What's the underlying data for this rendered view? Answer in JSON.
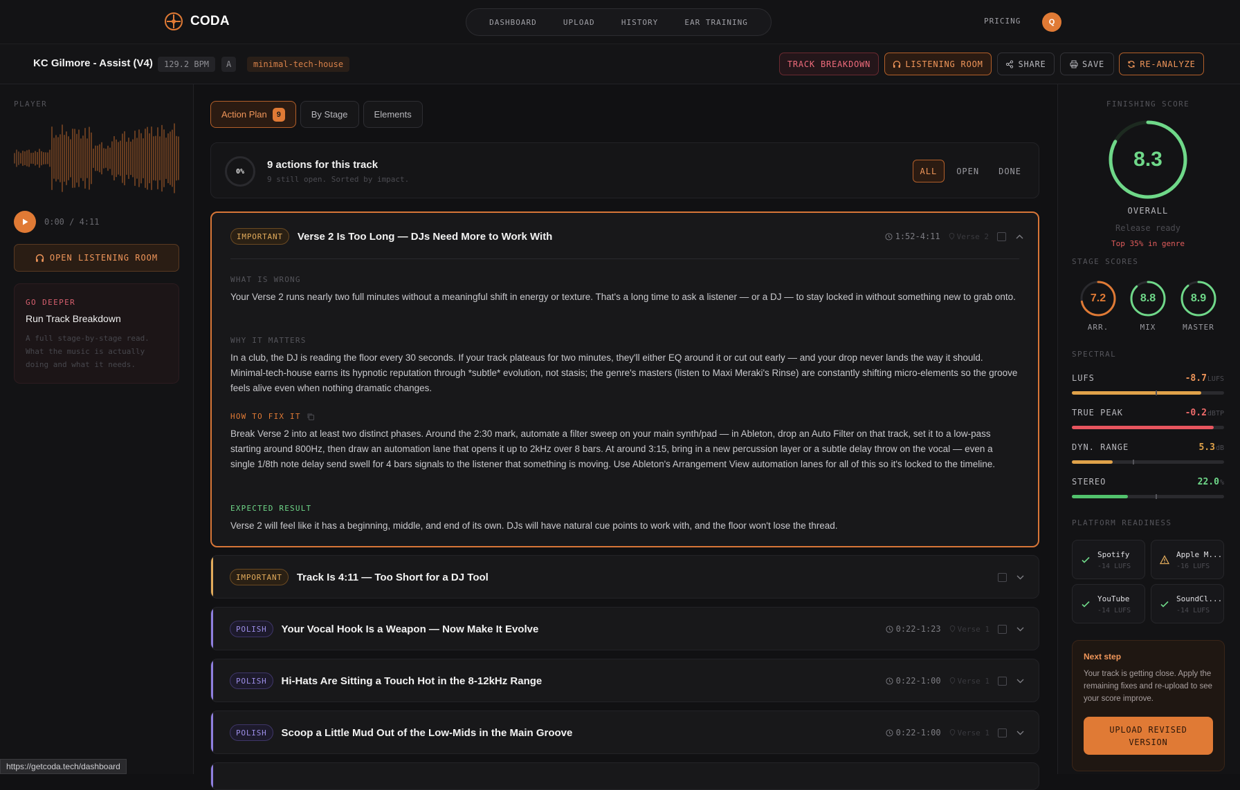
{
  "app": {
    "name": "CODA",
    "avatar_letter": "Q",
    "status_url": "https://getcoda.tech/dashboard"
  },
  "nav": {
    "items": [
      "DASHBOARD",
      "UPLOAD",
      "HISTORY",
      "EAR TRAINING"
    ],
    "pricing": "PRICING"
  },
  "track": {
    "title": "KC Gilmore - Assist (V4)",
    "bpm": "129.2 BPM",
    "key": "A",
    "genre": "minimal-tech-house",
    "buttons": {
      "breakdown": "TRACK BREAKDOWN",
      "listening": "LISTENING ROOM",
      "share": "SHARE",
      "save": "SAVE",
      "reanalyze": "RE-ANALYZE"
    }
  },
  "player": {
    "label": "PLAYER",
    "time": "0:00 / 4:11",
    "open_listening": "OPEN LISTENING ROOM",
    "go_deeper": {
      "eyebrow": "GO DEEPER",
      "title": "Run Track Breakdown",
      "desc": "A full stage-by-stage read. What the music is actually doing and what it needs."
    }
  },
  "tabs": [
    {
      "label": "Action Plan",
      "count": "9"
    },
    {
      "label": "By Stage"
    },
    {
      "label": "Elements"
    }
  ],
  "summary": {
    "pct": "0%",
    "title": "9 actions for this track",
    "sub": "9 still open. Sorted by impact.",
    "filters": [
      "ALL",
      "OPEN",
      "DONE"
    ]
  },
  "actions": [
    {
      "tag": "IMPORTANT",
      "title": "Verse 2 Is Too Long — DJs Need More to Work With",
      "time": "1:52-4:11",
      "section": "Verse 2",
      "wrong_label": "WHAT IS WRONG",
      "wrong": "Your Verse 2 runs nearly two full minutes without a meaningful shift in energy or texture. That's a long time to ask a listener — or a DJ — to stay locked in without something new to grab onto.",
      "why_label": "WHY IT MATTERS",
      "why": "In a club, the DJ is reading the floor every 30 seconds. If your track plateaus for two minutes, they'll either EQ around it or cut out early — and your drop never lands the way it should. Minimal-tech-house earns its hypnotic reputation through *subtle* evolution, not stasis; the genre's masters (listen to Maxi Meraki's Rinse) are constantly shifting micro-elements so the groove feels alive even when nothing dramatic changes.",
      "fix_label": "HOW TO FIX IT",
      "fix": "Break Verse 2 into at least two distinct phases. Around the 2:30 mark, automate a filter sweep on your main synth/pad — in Ableton, drop an Auto Filter on that track, set it to a low-pass starting around 800Hz, then draw an automation lane that opens it up to 2kHz over 8 bars. At around 3:15, bring in a new percussion layer or a subtle delay throw on the vocal — even a single 1/8th note delay send swell for 4 bars signals to the listener that something is moving. Use Ableton's Arrangement View automation lanes for all of this so it's locked to the timeline.",
      "result_label": "EXPECTED RESULT",
      "result": "Verse 2 will feel like it has a beginning, middle, and end of its own. DJs will have natural cue points to work with, and the floor won't lose the thread."
    },
    {
      "tag": "IMPORTANT",
      "title": "Track Is 4:11 — Too Short for a DJ Tool"
    },
    {
      "tag": "POLISH",
      "title": "Your Vocal Hook Is a Weapon — Now Make It Evolve",
      "time": "0:22-1:23",
      "section": "Verse 1"
    },
    {
      "tag": "POLISH",
      "title": "Hi-Hats Are Sitting a Touch Hot in the 8-12kHz Range",
      "time": "0:22-1:00",
      "section": "Verse 1"
    },
    {
      "tag": "POLISH",
      "title": "Scoop a Little Mud Out of the Low-Mids in the Main Groove",
      "time": "0:22-1:00",
      "section": "Verse 1"
    }
  ],
  "score": {
    "label": "FINISHING SCORE",
    "overall": "8.3",
    "overall_value": 8.3,
    "overall_label": "OVERALL",
    "status": "Release ready",
    "rank": "Top 35% in genre",
    "stages_label": "STAGE SCORES",
    "stages": [
      {
        "label": "ARR.",
        "value": "7.2",
        "num": 7.2,
        "color": "#e07a35"
      },
      {
        "label": "MIX",
        "value": "8.8",
        "num": 8.8,
        "color": "#6fd889"
      },
      {
        "label": "MASTER",
        "value": "8.9",
        "num": 8.9,
        "color": "#6fd889"
      }
    ]
  },
  "spectral": {
    "label": "SPECTRAL",
    "metrics": [
      {
        "name": "LUFS",
        "value": "-8.7",
        "unit": "LUFS",
        "level": 0.85,
        "target": 0.55,
        "color": "#e0a24a",
        "valcolor": "#f0965a"
      },
      {
        "name": "TRUE PEAK",
        "value": "-0.2",
        "unit": "dBTP",
        "level": 0.93,
        "color": "#e8555e",
        "valcolor": "#ef6b6b"
      },
      {
        "name": "DYN. RANGE",
        "value": "5.3",
        "unit": "dB",
        "level": 0.27,
        "target": 0.4,
        "color": "#e0a24a",
        "valcolor": "#e0a24a"
      },
      {
        "name": "STEREO",
        "value": "22.0",
        "unit": "%",
        "level": 0.37,
        "target": 0.55,
        "color": "#52c26d",
        "valcolor": "#6fd889"
      }
    ]
  },
  "platforms": {
    "label": "PLATFORM READINESS",
    "items": [
      {
        "name": "Spotify",
        "lufs": "-14 LUFS",
        "status": "ok"
      },
      {
        "name": "Apple M...",
        "lufs": "-16 LUFS",
        "status": "warn"
      },
      {
        "name": "YouTube",
        "lufs": "-14 LUFS",
        "status": "ok"
      },
      {
        "name": "SoundCl...",
        "lufs": "-14 LUFS",
        "status": "ok"
      }
    ]
  },
  "next_step": {
    "title": "Next step",
    "body": "Your track is getting close. Apply the remaining fixes and re-upload to see your score improve.",
    "button": "UPLOAD REVISED VERSION"
  },
  "colors": {
    "accent": "#e07a35",
    "important": "#e2ab5b",
    "polish": "#8f7fe0",
    "good": "#6fd889",
    "bad": "#e8555e"
  }
}
